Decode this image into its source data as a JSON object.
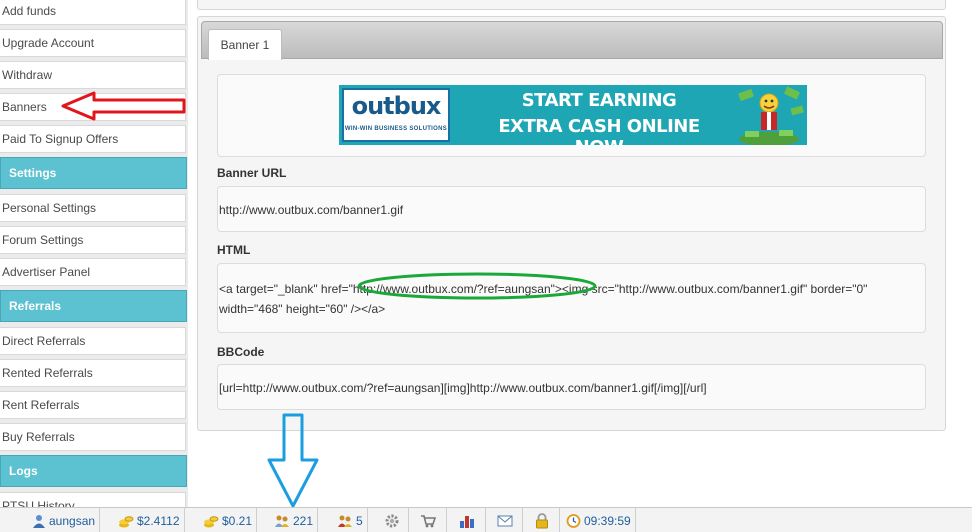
{
  "sidebar": {
    "items": [
      {
        "label": "Add funds"
      },
      {
        "label": "Upgrade Account"
      },
      {
        "label": "Withdraw"
      },
      {
        "label": "Banners"
      },
      {
        "label": "Paid To Signup Offers"
      }
    ],
    "settings_header": "Settings",
    "settings_items": [
      {
        "label": "Personal Settings"
      },
      {
        "label": "Forum Settings"
      },
      {
        "label": "Advertiser Panel"
      }
    ],
    "referrals_header": "Referrals",
    "referrals_items": [
      {
        "label": "Direct Referrals"
      },
      {
        "label": "Rented Referrals"
      },
      {
        "label": "Rent Referrals"
      },
      {
        "label": "Buy Referrals"
      }
    ],
    "logs_header": "Logs",
    "logs_items": [
      {
        "label": "PTSU History"
      }
    ]
  },
  "banner_tab": {
    "tab_label": "Banner 1",
    "banner_image": {
      "logo": "outbux",
      "logo_sub": "WIN-WIN BUSINESS SOLUTIONS",
      "line1": "START EARNING",
      "line2": "EXTRA CASH ONLINE NOW"
    },
    "banner_url_label": "Banner URL",
    "banner_url_value": "http://www.outbux.com/banner1.gif",
    "html_label": "HTML",
    "html_code": "<a target=\"_blank\" href=\"http://www.outbux.com/?ref=aungsan\"><img src=\"http://www.outbux.com/banner1.gif\" border=\"0\" width=\"468\" height=\"60\" /></a>",
    "bbcode_label": "BBCode",
    "bbcode_value": "[url=http://www.outbux.com/?ref=aungsan][img]http://www.outbux.com/banner1.gif[/img][/url]"
  },
  "taskbar": {
    "username": "aungsan",
    "balance_main": "$2.4112",
    "balance_purchase": "$0.21",
    "direct_referrals": "221",
    "rented_referrals": "5",
    "clock": "09:39:59",
    "icons": [
      "user-icon",
      "coins-icon",
      "coins-icon",
      "referrals-icon",
      "rented-referrals-icon",
      "gear-icon",
      "cart-icon",
      "stats-icon",
      "mail-icon",
      "lock-icon",
      "clock-icon"
    ]
  },
  "colors": {
    "sidebar_header": "#5cc1d0",
    "link": "#1e5e9e",
    "red_arrow": "#e0161b",
    "green_ellipse": "#1aa83a",
    "blue_arrow": "#1b9ee0"
  }
}
